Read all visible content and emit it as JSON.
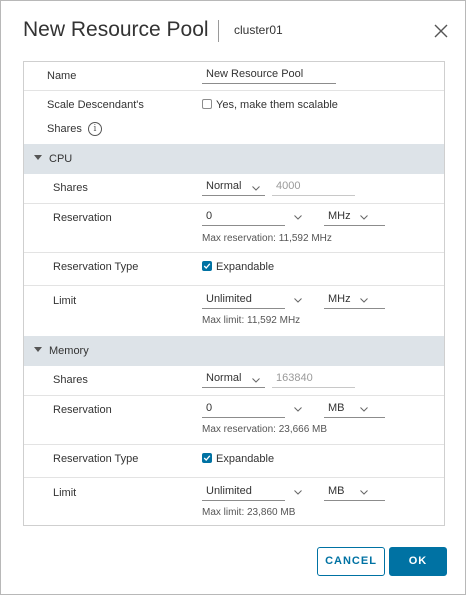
{
  "dialog": {
    "title": "New Resource Pool",
    "subtitle": "cluster01"
  },
  "general": {
    "name_label": "Name",
    "name_value": "New Resource Pool",
    "scale_label_1": "Scale Descendant's",
    "scale_label_2": "Shares",
    "scale_checkbox_label": "Yes, make them scalable",
    "scale_checked": false
  },
  "cpu": {
    "section_label": "CPU",
    "shares_label": "Shares",
    "shares_level": "Normal",
    "shares_value": "4000",
    "reservation_label": "Reservation",
    "reservation_value": "0",
    "reservation_unit": "MHz",
    "reservation_hint": "Max reservation: 11,592 MHz",
    "reservation_type_label": "Reservation Type",
    "expandable_label": "Expandable",
    "expandable_checked": true,
    "limit_label": "Limit",
    "limit_value": "Unlimited",
    "limit_unit": "MHz",
    "limit_hint": "Max limit: 11,592 MHz"
  },
  "memory": {
    "section_label": "Memory",
    "shares_label": "Shares",
    "shares_level": "Normal",
    "shares_value": "163840",
    "reservation_label": "Reservation",
    "reservation_value": "0",
    "reservation_unit": "MB",
    "reservation_hint": "Max reservation: 23,666 MB",
    "reservation_type_label": "Reservation Type",
    "expandable_label": "Expandable",
    "expandable_checked": true,
    "limit_label": "Limit",
    "limit_value": "Unlimited",
    "limit_unit": "MB",
    "limit_hint": "Max limit: 23,860 MB"
  },
  "buttons": {
    "cancel_label": "CANCEL",
    "ok_label": "OK"
  },
  "colors": {
    "accent": "#0072a3",
    "section_bg": "#dde3e8",
    "highlight": "#ffff7a"
  },
  "icons": {
    "close": "close-icon",
    "info": "info-icon",
    "caret": "caret-down-icon",
    "chevron": "chevron-down-icon",
    "check": "checkmark-icon"
  }
}
